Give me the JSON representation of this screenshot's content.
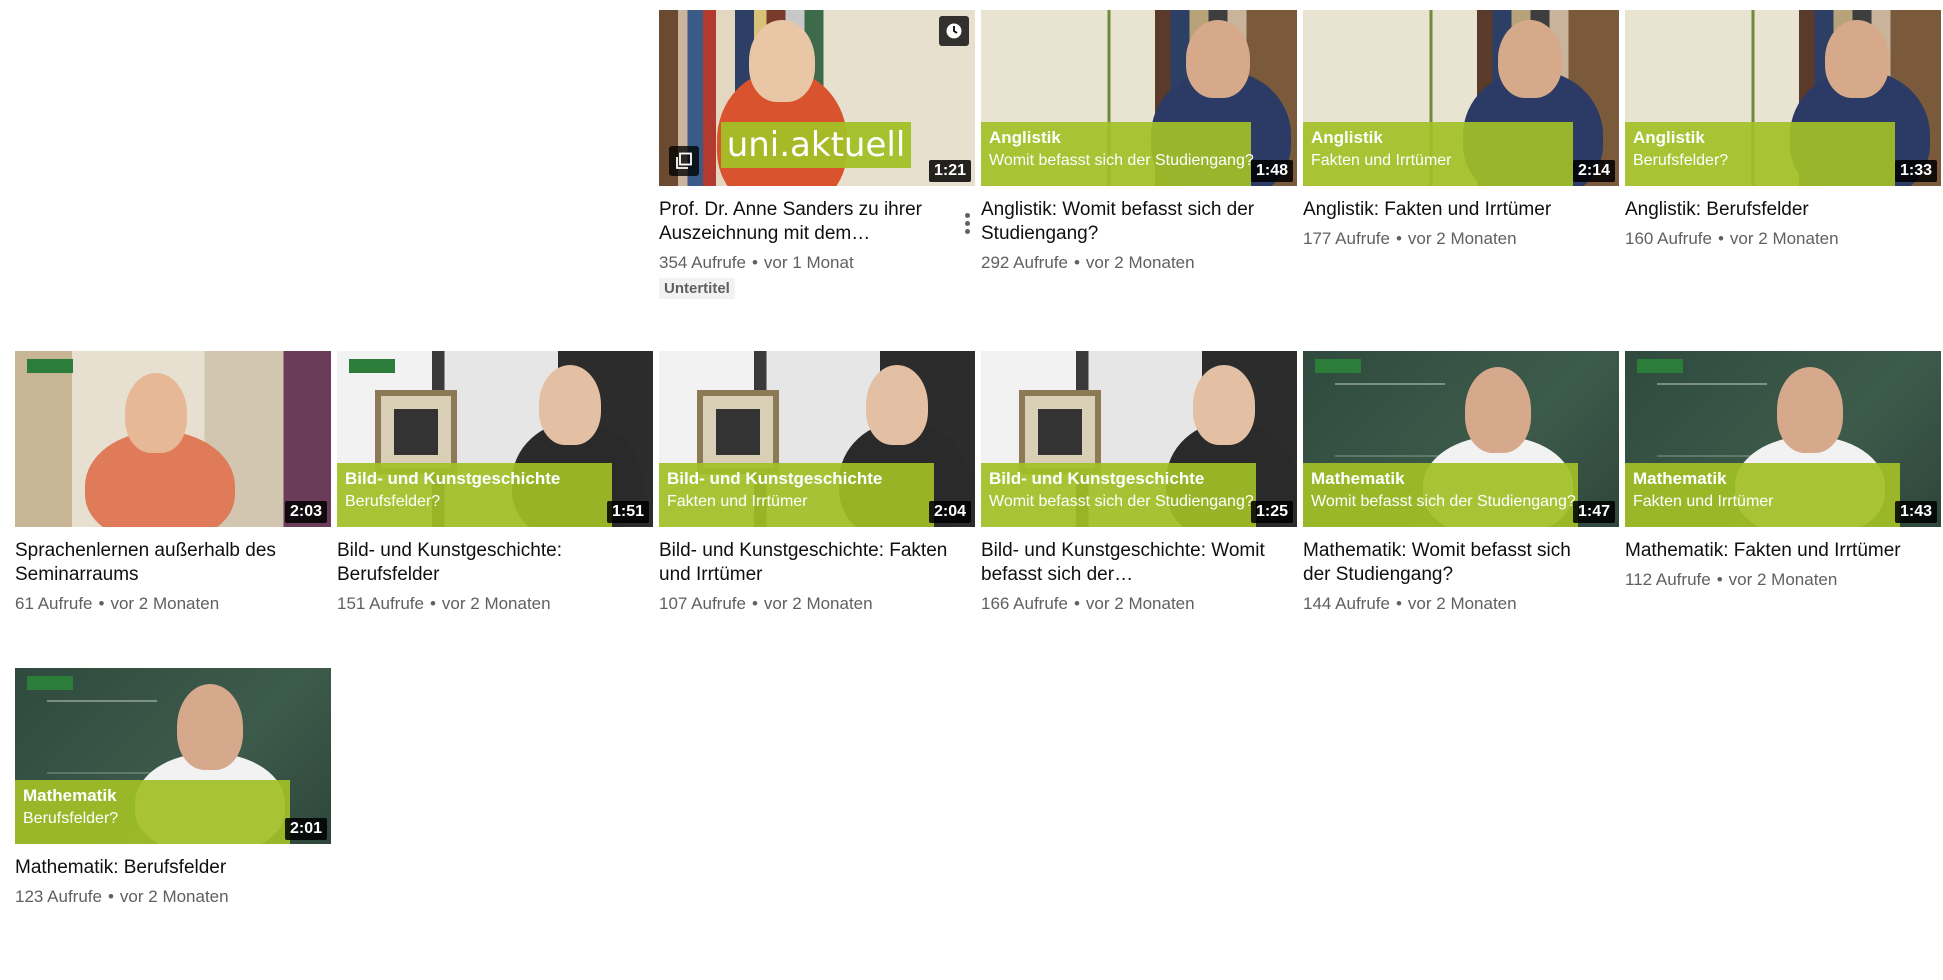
{
  "videos": [
    {
      "title": "Prof. Dr. Anne Sanders zu ihrer Auszeichnung mit dem…",
      "views": "354 Aufrufe",
      "age": "vor 1 Monat",
      "badge": "Untertitel",
      "duration": "1:21",
      "overlay_text": "uni.aktuell"
    },
    {
      "title": "Anglistik: Womit befasst sich der Studiengang?",
      "views": "292 Aufrufe",
      "age": "vor 2 Monaten",
      "duration": "1:48",
      "band_title": "Anglistik",
      "band_sub": "Womit befasst sich der Studiengang?"
    },
    {
      "title": "Anglistik: Fakten und Irrtümer",
      "views": "177 Aufrufe",
      "age": "vor 2 Monaten",
      "duration": "2:14",
      "band_title": "Anglistik",
      "band_sub": "Fakten und Irrtümer"
    },
    {
      "title": "Anglistik: Berufsfelder",
      "views": "160 Aufrufe",
      "age": "vor 2 Monaten",
      "duration": "1:33",
      "band_title": "Anglistik",
      "band_sub": "Berufsfelder?"
    },
    {
      "title": "Sprachenlernen außerhalb des Seminarraums",
      "views": "61 Aufrufe",
      "age": "vor 2 Monaten",
      "duration": "2:03"
    },
    {
      "title": "Bild- und Kunstgeschichte: Berufsfelder",
      "views": "151 Aufrufe",
      "age": "vor 2 Monaten",
      "duration": "1:51",
      "band_title": "Bild- und Kunstgeschichte",
      "band_sub": "Berufsfelder?"
    },
    {
      "title": "Bild- und Kunstgeschichte: Fakten und Irrtümer",
      "views": "107 Aufrufe",
      "age": "vor 2 Monaten",
      "duration": "2:04",
      "band_title": "Bild- und Kunstgeschichte",
      "band_sub": "Fakten und Irrtümer"
    },
    {
      "title": "Bild- und Kunstgeschichte: Womit befasst sich der…",
      "views": "166 Aufrufe",
      "age": "vor 2 Monaten",
      "duration": "1:25",
      "band_title": "Bild- und Kunstgeschichte",
      "band_sub": "Womit befasst sich der Studiengang?"
    },
    {
      "title": "Mathematik: Womit befasst sich der Studiengang?",
      "views": "144 Aufrufe",
      "age": "vor 2 Monaten",
      "duration": "1:47",
      "band_title": "Mathematik",
      "band_sub": "Womit befasst sich der Studiengang?"
    },
    {
      "title": "Mathematik: Fakten und Irrtümer",
      "views": "112 Aufrufe",
      "age": "vor 2 Monaten",
      "duration": "1:43",
      "band_title": "Mathematik",
      "band_sub": "Fakten und Irrtümer"
    },
    {
      "title": "Mathematik: Berufsfelder",
      "views": "123 Aufrufe",
      "age": "vor 2 Monaten",
      "duration": "2:01",
      "band_title": "Mathematik",
      "band_sub": "Berufsfelder?"
    }
  ],
  "icons": {
    "watch_later": "clock-icon",
    "add_to_queue": "queue-icon",
    "more": "more-vert-icon"
  },
  "colors": {
    "band": "#a2c026",
    "title": "#0f0f0f",
    "meta": "#606060"
  }
}
